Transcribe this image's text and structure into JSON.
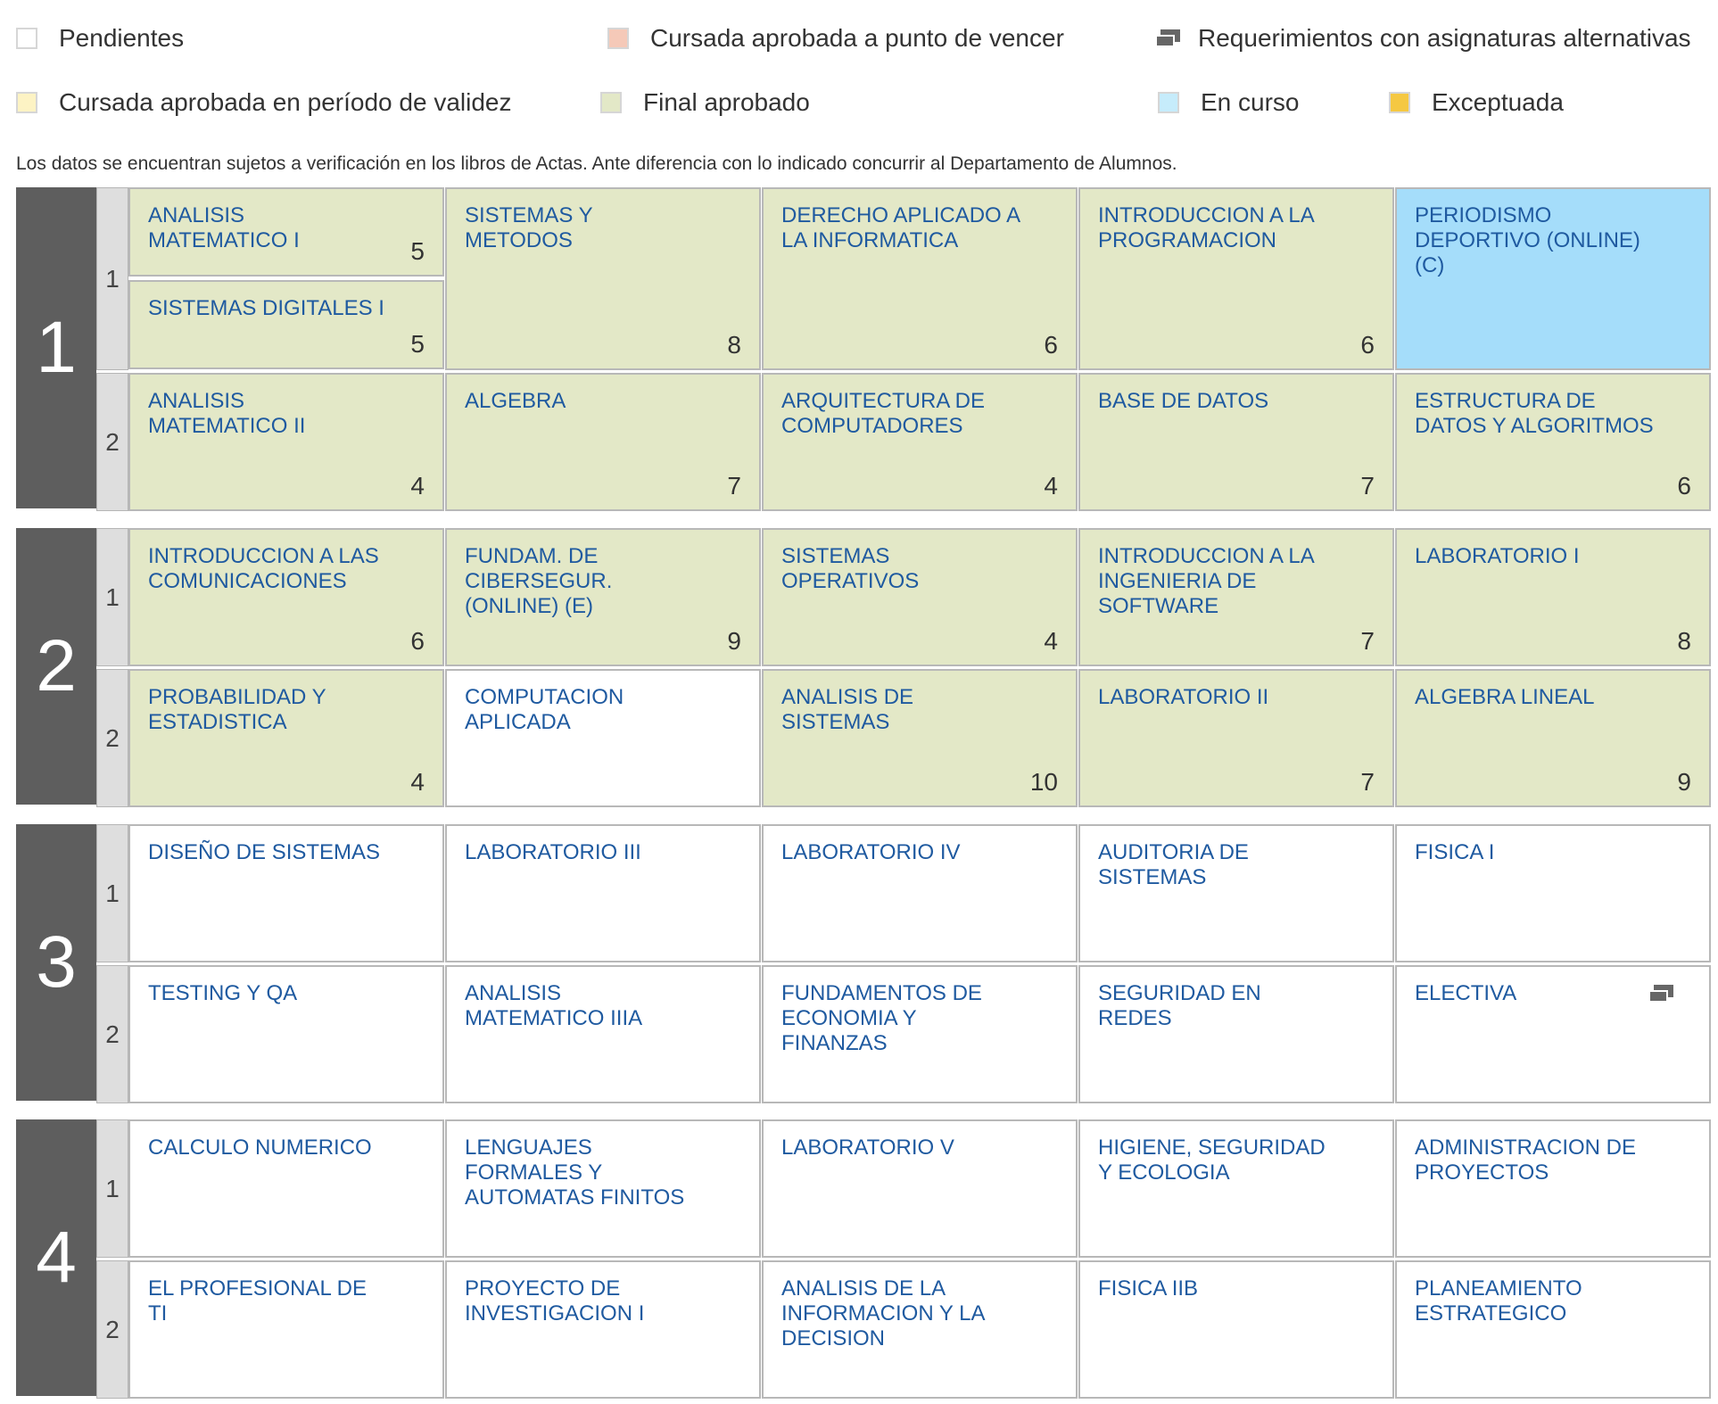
{
  "legend": {
    "pending": "Pendientes",
    "expiring": "Cursada aprobada a punto de vencer",
    "alternatives": "Requerimientos con asignaturas alternativas",
    "valid": "Cursada aprobada en período de validez",
    "final": "Final aprobado",
    "current": "En curso",
    "excepted": "Exceptuada"
  },
  "colors": {
    "pending": "#ffffff",
    "expiring": "#f5c9b8",
    "valid": "#fdf3c4",
    "final": "#e3e8c7",
    "current": "#c6ecfb",
    "excepted": "#f5c842",
    "year_bg": "#5e5e5e",
    "subject_text": "#1f5aa0"
  },
  "disclaimer": "Los datos se encuentran sujetos a verificación en los libros de Actas. Ante diferencia con lo indicado concurrir al Departamento de Alumnos.",
  "years": [
    {
      "number": "1",
      "semesters": [
        {
          "number": "1",
          "split": [
            {
              "name": "ANALISIS MATEMATICO I",
              "credits": "5",
              "status": "final"
            },
            {
              "name": "SISTEMAS DIGITALES I",
              "credits": "5",
              "status": "final"
            }
          ],
          "subjects": [
            {
              "name": "SISTEMAS Y METODOS",
              "credits": "8",
              "status": "final"
            },
            {
              "name": "DERECHO APLICADO A LA INFORMATICA",
              "credits": "6",
              "status": "final"
            },
            {
              "name": "INTRODUCCION A LA PROGRAMACION",
              "credits": "6",
              "status": "final"
            },
            {
              "name": "PERIODISMO DEPORTIVO (ONLINE) (C)",
              "credits": "",
              "status": "encurso"
            }
          ]
        },
        {
          "number": "2",
          "subjects": [
            {
              "name": "ANALISIS MATEMATICO II",
              "credits": "4",
              "status": "final"
            },
            {
              "name": "ALGEBRA",
              "credits": "7",
              "status": "final"
            },
            {
              "name": "ARQUITECTURA DE COMPUTADORES",
              "credits": "4",
              "status": "final"
            },
            {
              "name": "BASE DE DATOS",
              "credits": "7",
              "status": "final"
            },
            {
              "name": "ESTRUCTURA DE DATOS Y ALGORITMOS",
              "credits": "6",
              "status": "final"
            }
          ]
        }
      ]
    },
    {
      "number": "2",
      "semesters": [
        {
          "number": "1",
          "subjects": [
            {
              "name": "INTRODUCCION A LAS COMUNICACIONES",
              "credits": "6",
              "status": "final"
            },
            {
              "name": "FUNDAM. DE CIBERSEGUR. (ONLINE) (E)",
              "credits": "9",
              "status": "final"
            },
            {
              "name": "SISTEMAS OPERATIVOS",
              "credits": "4",
              "status": "final"
            },
            {
              "name": "INTRODUCCION A LA INGENIERIA DE SOFTWARE",
              "credits": "7",
              "status": "final"
            },
            {
              "name": "LABORATORIO I",
              "credits": "8",
              "status": "final"
            }
          ]
        },
        {
          "number": "2",
          "subjects": [
            {
              "name": "PROBABILIDAD Y ESTADISTICA",
              "credits": "4",
              "status": "final"
            },
            {
              "name": "COMPUTACION APLICADA",
              "credits": "",
              "status": "pending"
            },
            {
              "name": "ANALISIS DE SISTEMAS",
              "credits": "10",
              "status": "final"
            },
            {
              "name": "LABORATORIO II",
              "credits": "7",
              "status": "final"
            },
            {
              "name": "ALGEBRA LINEAL",
              "credits": "9",
              "status": "final"
            }
          ]
        }
      ]
    },
    {
      "number": "3",
      "semesters": [
        {
          "number": "1",
          "subjects": [
            {
              "name": "DISEÑO DE SISTEMAS",
              "credits": "",
              "status": "pending"
            },
            {
              "name": "LABORATORIO III",
              "credits": "",
              "status": "pending"
            },
            {
              "name": "LABORATORIO IV",
              "credits": "",
              "status": "pending"
            },
            {
              "name": "AUDITORIA DE SISTEMAS",
              "credits": "",
              "status": "pending"
            },
            {
              "name": "FISICA I",
              "credits": "",
              "status": "pending"
            }
          ]
        },
        {
          "number": "2",
          "subjects": [
            {
              "name": "TESTING Y QA",
              "credits": "",
              "status": "pending"
            },
            {
              "name": "ANALISIS MATEMATICO IIIA",
              "credits": "",
              "status": "pending"
            },
            {
              "name": "FUNDAMENTOS DE ECONOMIA Y FINANZAS",
              "credits": "",
              "status": "pending"
            },
            {
              "name": "SEGURIDAD EN REDES",
              "credits": "",
              "status": "pending"
            },
            {
              "name": "ELECTIVA",
              "credits": "",
              "status": "pending",
              "alternatives": true
            }
          ]
        }
      ]
    },
    {
      "number": "4",
      "semesters": [
        {
          "number": "1",
          "subjects": [
            {
              "name": "CALCULO NUMERICO",
              "credits": "",
              "status": "pending"
            },
            {
              "name": "LENGUAJES FORMALES Y AUTOMATAS FINITOS",
              "credits": "",
              "status": "pending"
            },
            {
              "name": "LABORATORIO V",
              "credits": "",
              "status": "pending"
            },
            {
              "name": "HIGIENE, SEGURIDAD Y ECOLOGIA",
              "credits": "",
              "status": "pending"
            },
            {
              "name": "ADMINISTRACION DE PROYECTOS",
              "credits": "",
              "status": "pending"
            }
          ]
        },
        {
          "number": "2",
          "subjects": [
            {
              "name": "EL PROFESIONAL DE TI",
              "credits": "",
              "status": "pending"
            },
            {
              "name": "PROYECTO DE INVESTIGACION I",
              "credits": "",
              "status": "pending"
            },
            {
              "name": "ANALISIS DE LA INFORMACION Y LA DECISION",
              "credits": "",
              "status": "pending"
            },
            {
              "name": "FISICA IIB",
              "credits": "",
              "status": "pending"
            },
            {
              "name": "PLANEAMIENTO ESTRATEGICO",
              "credits": "",
              "status": "pending"
            }
          ]
        }
      ]
    }
  ]
}
